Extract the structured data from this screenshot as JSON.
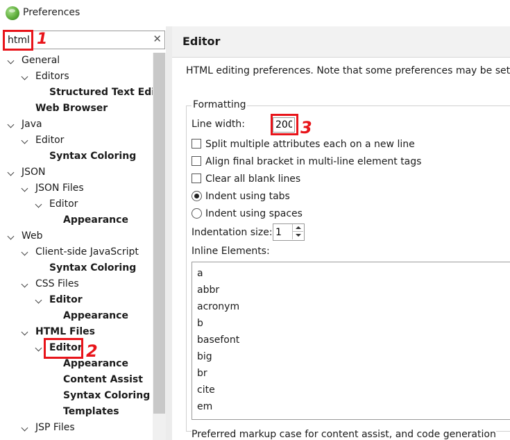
{
  "window": {
    "title": "Preferences"
  },
  "filter": {
    "value": "html"
  },
  "tree": [
    {
      "label": "General",
      "level": 0,
      "expanded": true,
      "bold": false
    },
    {
      "label": "Editors",
      "level": 1,
      "expanded": true,
      "bold": false
    },
    {
      "label": "Structured Text Editors",
      "level": 2,
      "leaf": true,
      "bold": true
    },
    {
      "label": "Web Browser",
      "level": 1,
      "leaf": true,
      "bold": true
    },
    {
      "label": "Java",
      "level": 0,
      "expanded": true,
      "bold": false
    },
    {
      "label": "Editor",
      "level": 1,
      "expanded": true,
      "bold": false
    },
    {
      "label": "Syntax Coloring",
      "level": 2,
      "leaf": true,
      "bold": true
    },
    {
      "label": "JSON",
      "level": 0,
      "expanded": true,
      "bold": false
    },
    {
      "label": "JSON Files",
      "level": 1,
      "expanded": true,
      "bold": false
    },
    {
      "label": "Editor",
      "level": 2,
      "expanded": true,
      "bold": false
    },
    {
      "label": "Appearance",
      "level": 3,
      "leaf": true,
      "bold": true
    },
    {
      "label": "Web",
      "level": 0,
      "expanded": true,
      "bold": false
    },
    {
      "label": "Client-side JavaScript",
      "level": 1,
      "expanded": true,
      "bold": false
    },
    {
      "label": "Syntax Coloring",
      "level": 2,
      "leaf": true,
      "bold": true
    },
    {
      "label": "CSS Files",
      "level": 1,
      "expanded": true,
      "bold": false
    },
    {
      "label": "Editor",
      "level": 2,
      "expanded": true,
      "bold": true
    },
    {
      "label": "Appearance",
      "level": 3,
      "leaf": true,
      "bold": true
    },
    {
      "label": "HTML Files",
      "level": 1,
      "expanded": true,
      "bold": true
    },
    {
      "label": "Editor",
      "level": 2,
      "expanded": true,
      "bold": true,
      "selected": true
    },
    {
      "label": "Appearance",
      "level": 3,
      "leaf": true,
      "bold": true
    },
    {
      "label": "Content Assist",
      "level": 3,
      "leaf": true,
      "bold": true
    },
    {
      "label": "Syntax Coloring",
      "level": 3,
      "leaf": true,
      "bold": true
    },
    {
      "label": "Templates",
      "level": 3,
      "leaf": true,
      "bold": true
    },
    {
      "label": "JSP Files",
      "level": 1,
      "expanded": true,
      "bold": false
    }
  ],
  "page": {
    "title": "Editor",
    "description": "HTML editing preferences.  Note that some preferences may be set o",
    "formatting": {
      "legend": "Formatting",
      "line_width_label": "Line width:",
      "line_width_value": "200",
      "options": [
        {
          "type": "checkbox",
          "label": "Split multiple attributes each on a new line",
          "checked": false
        },
        {
          "type": "checkbox",
          "label": "Align final bracket in multi-line element tags",
          "checked": false
        },
        {
          "type": "checkbox",
          "label": "Clear all blank lines",
          "checked": false
        },
        {
          "type": "radio",
          "label": "Indent using tabs",
          "checked": true
        },
        {
          "type": "radio",
          "label": "Indent using spaces",
          "checked": false
        }
      ],
      "indentation_label": "Indentation size:",
      "indentation_value": "1",
      "inline_label": "Inline Elements:",
      "inline_elements": [
        "a",
        "abbr",
        "acronym",
        "b",
        "basefont",
        "big",
        "br",
        "cite",
        "em"
      ]
    },
    "bottom_text": "Preferred markup case for content assist, and code generation"
  },
  "annotations": [
    "1",
    "2",
    "3"
  ],
  "colors": {
    "annotation": "#e8141a"
  }
}
